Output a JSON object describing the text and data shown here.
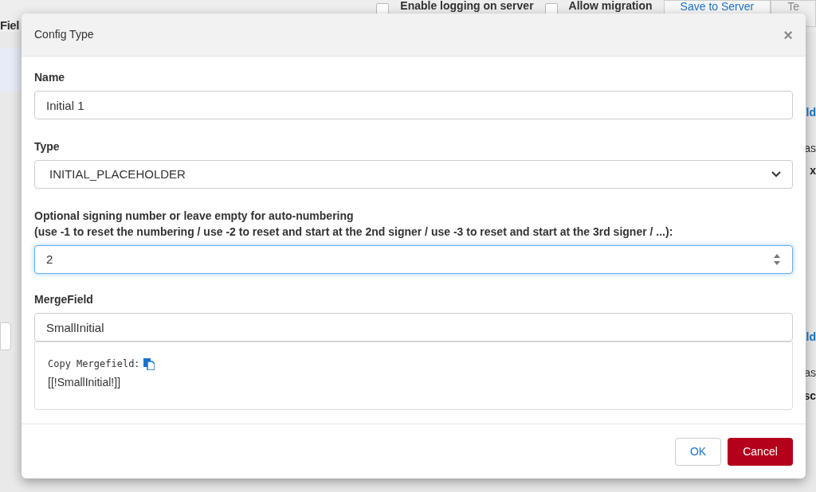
{
  "background": {
    "title": "Fiel",
    "options": [
      {
        "label": "Enable logging on server",
        "checked": false
      },
      {
        "label": "Allow migration",
        "checked": false
      }
    ],
    "buttons": [
      {
        "label": "Save to Server",
        "kind": "link"
      },
      {
        "label": "Te",
        "kind": "plain"
      }
    ],
    "right_fragments": [
      {
        "text": "ld",
        "kind": "link"
      },
      {
        "text": "as",
        "kind": "plain"
      },
      {
        "text": "x",
        "kind": "bold"
      },
      {
        "text": "ld",
        "kind": "link"
      },
      {
        "text": "as",
        "kind": "plain"
      },
      {
        "text": "sc",
        "kind": "bold"
      }
    ]
  },
  "dialog": {
    "title": "Config Type",
    "close": "×",
    "fields": [
      {
        "kind": "text",
        "label": "Name",
        "value": "Initial 1",
        "focused": false
      },
      {
        "kind": "select",
        "label": "Type",
        "value": "INITIAL_PLACEHOLDER",
        "focused": false
      },
      {
        "kind": "number",
        "label": "Optional signing number or leave empty for auto-numbering",
        "hint": "(use -1 to reset the numbering / use -2 to reset and start at the 2nd signer / use -3 to reset and start at the 3rd signer / ...):",
        "value": "2",
        "focused": true
      },
      {
        "kind": "text",
        "label": "MergeField",
        "value": "SmallInitial",
        "focused": false
      }
    ],
    "mergefield": {
      "copy_label": "Copy Mergefield:",
      "value": "[[!SmallInitial!]]"
    },
    "buttons": [
      {
        "label": "OK",
        "kind": "secondary"
      },
      {
        "label": "Cancel",
        "kind": "danger"
      }
    ]
  }
}
